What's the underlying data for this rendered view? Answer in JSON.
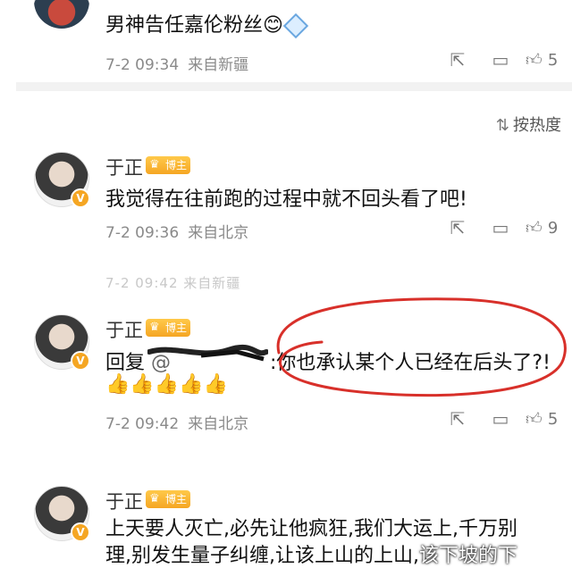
{
  "comment_top": {
    "text": "男神告任嘉伦粉丝",
    "emoji": "😊",
    "time": "7-2 09:34",
    "source": "来自新疆",
    "likes": "5"
  },
  "sort_label": "按热度",
  "comments": [
    {
      "name": "于正",
      "badge": "博主",
      "text": "我觉得在往前跑的过程中就不回头看了吧!",
      "time": "7-2 09:36",
      "source": "来自北京",
      "likes": "9"
    },
    {
      "name": "于正",
      "badge": "博主",
      "reply_prefix": "回复",
      "at": "@",
      "text": ":你也承认某个人已经在后头了?!",
      "thumbs": "👍👍👍👍👍",
      "time": "7-2 09:42",
      "source": "来自北京",
      "likes": "5"
    },
    {
      "name": "于正",
      "badge": "博主",
      "text_line1": "上天要人灭亡,必先让他疯狂,我们大运上,千万别",
      "text_line2": "理,别发生量子纠缠,让该上山的上山,",
      "watermark": "该下坡的下"
    }
  ],
  "ghost_text": "7-2 09:42 来自新疆",
  "colors": {
    "annotation": "#d8302a",
    "badge": "#f5a623",
    "meta": "#8a8a8a"
  }
}
